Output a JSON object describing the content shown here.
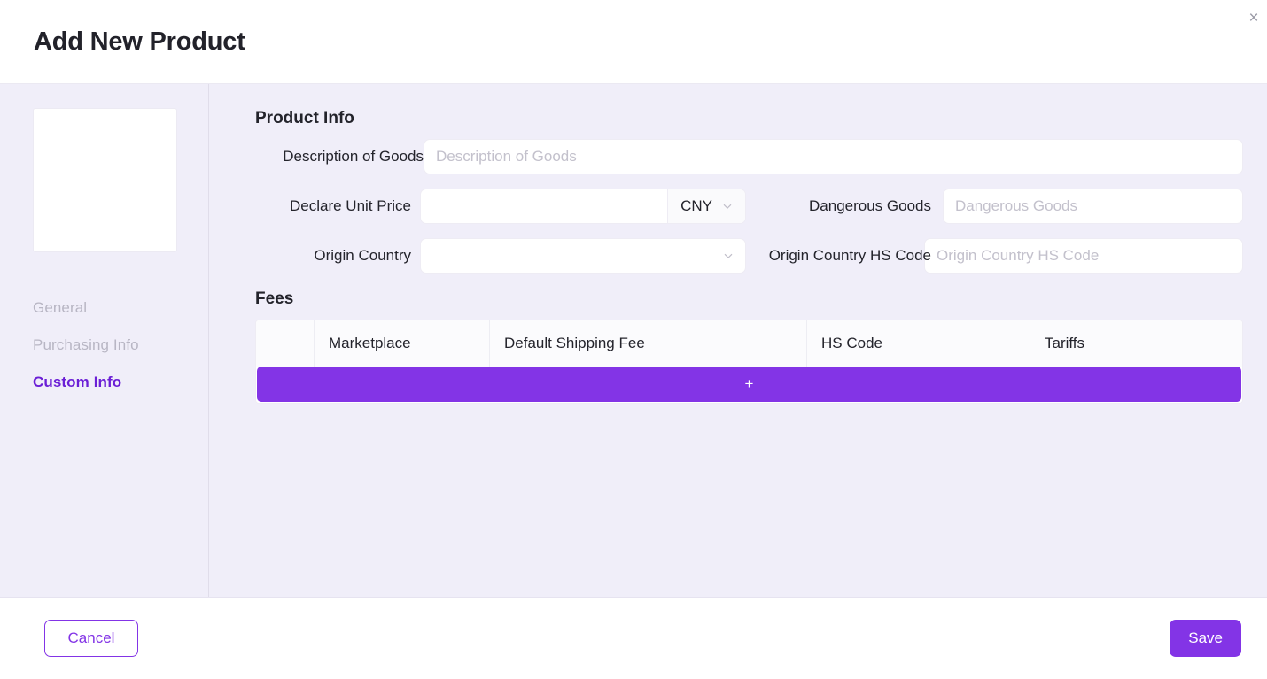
{
  "header": {
    "title": "Add New Product",
    "close_label": "×"
  },
  "sidebar": {
    "image_placeholder_name": "product-image-upload",
    "items": [
      {
        "label": "General",
        "active": false
      },
      {
        "label": "Purchasing Info",
        "active": false
      },
      {
        "label": "Custom Info",
        "active": true
      }
    ]
  },
  "content": {
    "product_info": {
      "title": "Product Info",
      "fields": {
        "description": {
          "label": "Description of Goods",
          "placeholder": "Description of Goods",
          "value": ""
        },
        "declare_unit_price": {
          "label": "Declare Unit Price",
          "placeholder": "",
          "value": "",
          "currency": "CNY"
        },
        "dangerous_goods": {
          "label": "Dangerous Goods",
          "placeholder": "Dangerous Goods",
          "value": ""
        },
        "origin_country": {
          "label": "Origin Country",
          "placeholder": "",
          "value": ""
        },
        "origin_country_hs_code": {
          "label": "Origin Country HS Code",
          "placeholder": "Origin Country HS Code",
          "value": ""
        }
      }
    },
    "fees": {
      "title": "Fees",
      "columns": [
        "",
        "Marketplace",
        "Default Shipping Fee",
        "HS Code",
        "Tariffs"
      ],
      "rows": [],
      "add_button_label": "+"
    }
  },
  "footer": {
    "cancel_label": "Cancel",
    "save_label": "Save"
  },
  "colors": {
    "accent": "#8334E6",
    "accent_text": "#6B1FD6",
    "body_background": "#F0EEF9",
    "panel_background": "#FFFFFF",
    "muted_text": "#B8B6C4",
    "placeholder_text": "#C3C1CC"
  }
}
